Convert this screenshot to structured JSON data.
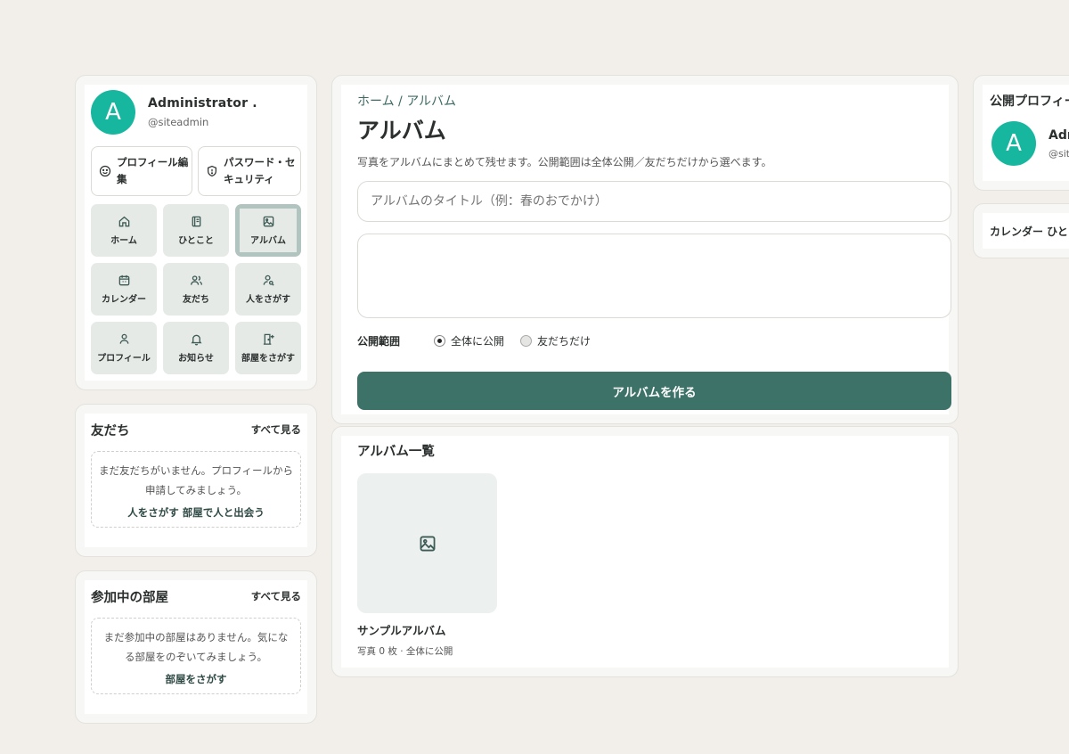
{
  "profile": {
    "avatar_letter": "A",
    "name": "Administrator .",
    "handle": "@siteadmin",
    "edit_profile": "プロフィール編集",
    "password_security": "パスワード・セキュリティ"
  },
  "nav_tiles": [
    {
      "label": "ホーム",
      "icon": "home-icon"
    },
    {
      "label": "ひとこと",
      "icon": "notebook-icon"
    },
    {
      "label": "アルバム",
      "icon": "image-icon",
      "active": true
    },
    {
      "label": "カレンダー",
      "icon": "calendar-icon"
    },
    {
      "label": "友だち",
      "icon": "users-icon"
    },
    {
      "label": "人をさがす",
      "icon": "user-search-icon"
    },
    {
      "label": "プロフィール",
      "icon": "user-icon"
    },
    {
      "label": "お知らせ",
      "icon": "bell-icon"
    },
    {
      "label": "部屋をさがす",
      "icon": "door-icon"
    }
  ],
  "friends": {
    "title": "友だち",
    "see_all": "すべて見る",
    "empty_text": "まだ友だちがいません。プロフィールから申請してみましょう。",
    "link_find_people": "人をさがす",
    "link_meet": "部屋で人と出会う"
  },
  "rooms": {
    "title": "参加中の部屋",
    "see_all": "すべて見る",
    "empty_text": "まだ参加中の部屋はありません。気になる部屋をのぞいてみましょう。",
    "link_find_rooms": "部屋をさがす"
  },
  "main": {
    "breadcrumb": "ホーム / アルバム",
    "title": "アルバム",
    "description": "写真をアルバムにまとめて残せます。公開範囲は全体公開／友だちだけから選べます。",
    "title_placeholder": "アルバムのタイトル（例：春のおでかけ）",
    "visibility_label": "公開範囲",
    "option_public": "全体に公開",
    "option_friends": "友だちだけ",
    "selected_visibility": "全体に公開",
    "create_button": "アルバムを作る"
  },
  "album_list": {
    "title": "アルバム一覧",
    "albums": [
      {
        "name": "サンプルアルバム",
        "meta": "写真 0 枚 · 全体に公開"
      }
    ]
  },
  "right": {
    "public_profile_title": "公開プロフィール",
    "avatar_letter": "A",
    "name": "Administrator .",
    "handle": "@siteadmin",
    "calendar_text": "カレンダー ひとこと"
  },
  "colors": {
    "accent": "#3d7269",
    "avatar": "#17b79f",
    "background": "#f2efea"
  }
}
